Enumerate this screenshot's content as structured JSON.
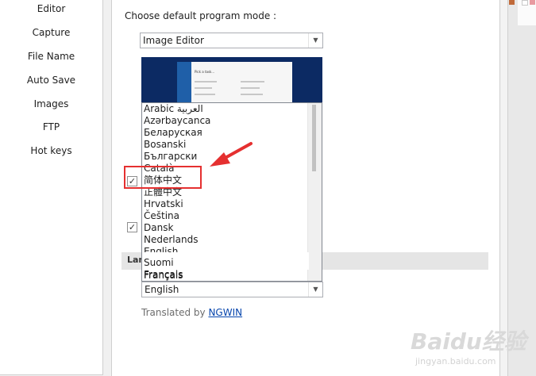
{
  "sidebar": {
    "items": [
      {
        "label": "Editor"
      },
      {
        "label": "Capture"
      },
      {
        "label": "File Name"
      },
      {
        "label": "Auto Save"
      },
      {
        "label": "Images"
      },
      {
        "label": "FTP"
      },
      {
        "label": "Hot keys"
      }
    ]
  },
  "main": {
    "section_title": "Choose default program mode :",
    "mode_select": {
      "value": "Image Editor"
    },
    "preview": {
      "caption": "Pick a task..."
    },
    "language_list": {
      "items": [
        "Arabic العربية",
        "Azərbaycanca",
        "Беларуская",
        "Bosanski",
        "Български",
        "Català",
        "简体中文",
        "正體中文",
        "Hrvatski",
        "Čeština",
        "Dansk",
        "Nederlands",
        "English",
        "Suomi",
        "Français"
      ],
      "highlighted": "简体中文"
    },
    "checkboxes": [
      {
        "checked": true,
        "mark": "✓"
      },
      {
        "checked": true,
        "mark": "✓"
      }
    ],
    "language_section_header": "Lan",
    "language_select": {
      "value": "English"
    },
    "credit": {
      "prefix": "Translated by ",
      "link": "NGWIN"
    }
  },
  "watermark": {
    "text": "Baidu经验",
    "url": "jingyan.baidu.com"
  },
  "colors": {
    "annotation": "#e53030",
    "preview_bg": "#0c2a63",
    "link": "#0645ad"
  }
}
